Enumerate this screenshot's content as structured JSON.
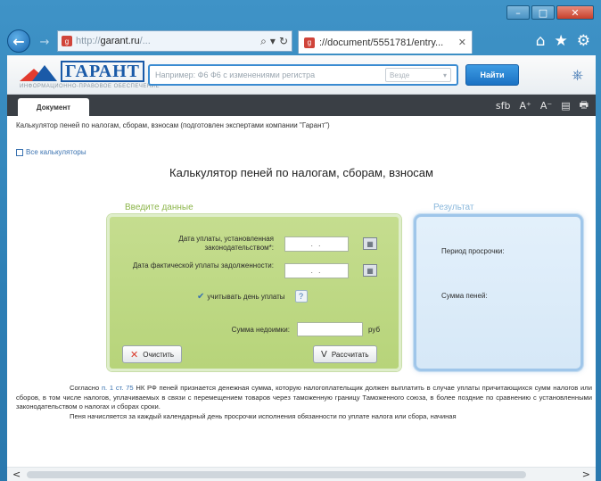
{
  "browser": {
    "address_url_prefix": "http://",
    "address_domain": "garant.ru",
    "address_url_suffix": "/...",
    "tab_title": "://document/5551781/entry...",
    "back_icon": "back-arrow-icon",
    "home_icon": "home-icon"
  },
  "site": {
    "logo_text": "ГАРАНТ",
    "logo_sub": "ИНФОРМАЦИОННО-ПРАВОВОЕ ОБЕСПЕЧЕНИЕ",
    "search_placeholder": "Например: Ф6 Ф6 с изменениями регистра",
    "search_select": "Везде",
    "find_button": "Найти"
  },
  "docbar": {
    "tab_label": "Документ",
    "tools": [
      "sfb",
      "A⁺",
      "A⁻",
      "▤",
      "🖶"
    ]
  },
  "breadcrumb": "Калькулятор пеней по налогам, сборам, взносам (подготовлен экспертами компании \"Гарант\")",
  "all_calculators_link": "Все калькуляторы",
  "page_title": "Калькулятор пеней по налогам, сборам, взносам",
  "input_panel": {
    "legend": "Введите данные",
    "payment_date_label": "Дата уплаты, установленная законодательством*:",
    "actual_date_label": "Дата фактической уплаты задолженности:",
    "date_placeholder": ". .",
    "include_day_label": "учитывать день уплаты",
    "help_label": "?",
    "debt_sum_label": "Сумма недоимки:",
    "currency": "руб",
    "clear_button": "Очистить",
    "calc_button": "Рассчитать"
  },
  "result_panel": {
    "legend": "Результат",
    "overdue_period_label": "Период просрочки:",
    "penalty_sum_label": "Сумма пеней:"
  },
  "body": {
    "p1_prefix": "Согласно",
    "p1_link": "п. 1 ст. 75",
    "p1_text": "НК РФ пеней признается денежная сумма, которую налогоплательщик должен выплатить в случае уплаты причитающихся сумм налогов или сборов, в том числе налогов, уплачиваемых в связи с перемещением товаров через таможенную границу Таможенного союза, в более поздние по сравнению с установленными законодательством о налогах и сборах сроки.",
    "p2_text": "Пеня начисляется за каждый календарный день просрочки исполнения обязанности по уплате налога или сбора, начиная"
  },
  "scrollbar": {
    "left": "<",
    "right": ">"
  },
  "colors": {
    "input_panel": "#bcd783",
    "result_panel": "#dbeaf8",
    "accent_blue": "#1b72c4",
    "frame": "#3a8bc2"
  }
}
